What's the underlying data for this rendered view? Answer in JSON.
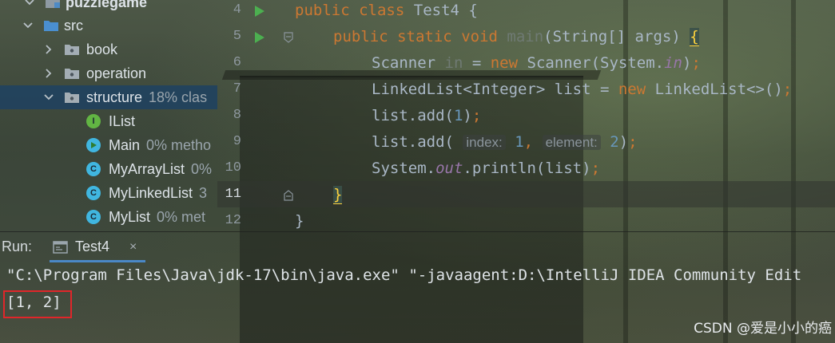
{
  "project_tree": {
    "items": [
      {
        "label": "puzzlegame",
        "hint": ""
      },
      {
        "label": "src",
        "hint": ""
      },
      {
        "label": "book",
        "hint": ""
      },
      {
        "label": "operation",
        "hint": ""
      },
      {
        "label": "structure",
        "hint": "18% clas"
      },
      {
        "label": "IList",
        "hint": "",
        "icon_letter": "I"
      },
      {
        "label": "Main",
        "hint": "0% metho"
      },
      {
        "label": "MyArrayList",
        "hint": "0%"
      },
      {
        "label": "MyLinkedList",
        "hint": "3"
      },
      {
        "label": "MyList",
        "hint": "0% met"
      }
    ]
  },
  "editor": {
    "line_numbers": [
      "4",
      "5",
      "6",
      "7",
      "8",
      "9",
      "10",
      "11",
      "12"
    ],
    "line4": {
      "kw1": "public",
      "kw2": "class",
      "name": "Test4 {"
    },
    "line5": {
      "kw1": "public",
      "kw2": "static",
      "kw3": "void",
      "name": "main",
      "params": "(String[] args) ",
      "brace": "{"
    },
    "line6": {
      "a": "Scanner ",
      "dim": "in",
      "b": " = ",
      "kw": "new",
      "c": " Scanner(System.",
      "fld": "in",
      "d": ")",
      "semi": ";"
    },
    "line7": {
      "a": "LinkedList<Integer> list = ",
      "kw": "new",
      "b": " LinkedList<>()",
      "semi": ";"
    },
    "line8": {
      "a": "list.add(",
      "num": "1",
      "b": ")",
      "semi": ";"
    },
    "line9": {
      "a": "list.add( ",
      "hint1": "index:",
      "num1": "1",
      "comma": ",",
      "hint2": "element:",
      "num2": "2",
      "b": ")",
      "semi": ";"
    },
    "line10": {
      "a": "System.",
      "fld": "out",
      "b": ".println(list)",
      "semi": ";"
    },
    "line11": {
      "brace": "}"
    },
    "line12": {
      "brace": "}"
    }
  },
  "run_panel": {
    "label": "Run:",
    "tab": "Test4",
    "close": "×",
    "console_lines": [
      "\"C:\\Program Files\\Java\\jdk-17\\bin\\java.exe\" \"-javaagent:D:\\IntelliJ IDEA Community Edit",
      "[1, 2]"
    ]
  },
  "watermark": "CSDN @爱是小小的癌",
  "colors": {
    "keyword": "#cc7832",
    "number": "#6897bb",
    "field": "#9876aa",
    "text": "#a9b7c6",
    "run_icon": "#4caf50",
    "selection": "#21425e",
    "highlight_box": "#e0262a"
  }
}
